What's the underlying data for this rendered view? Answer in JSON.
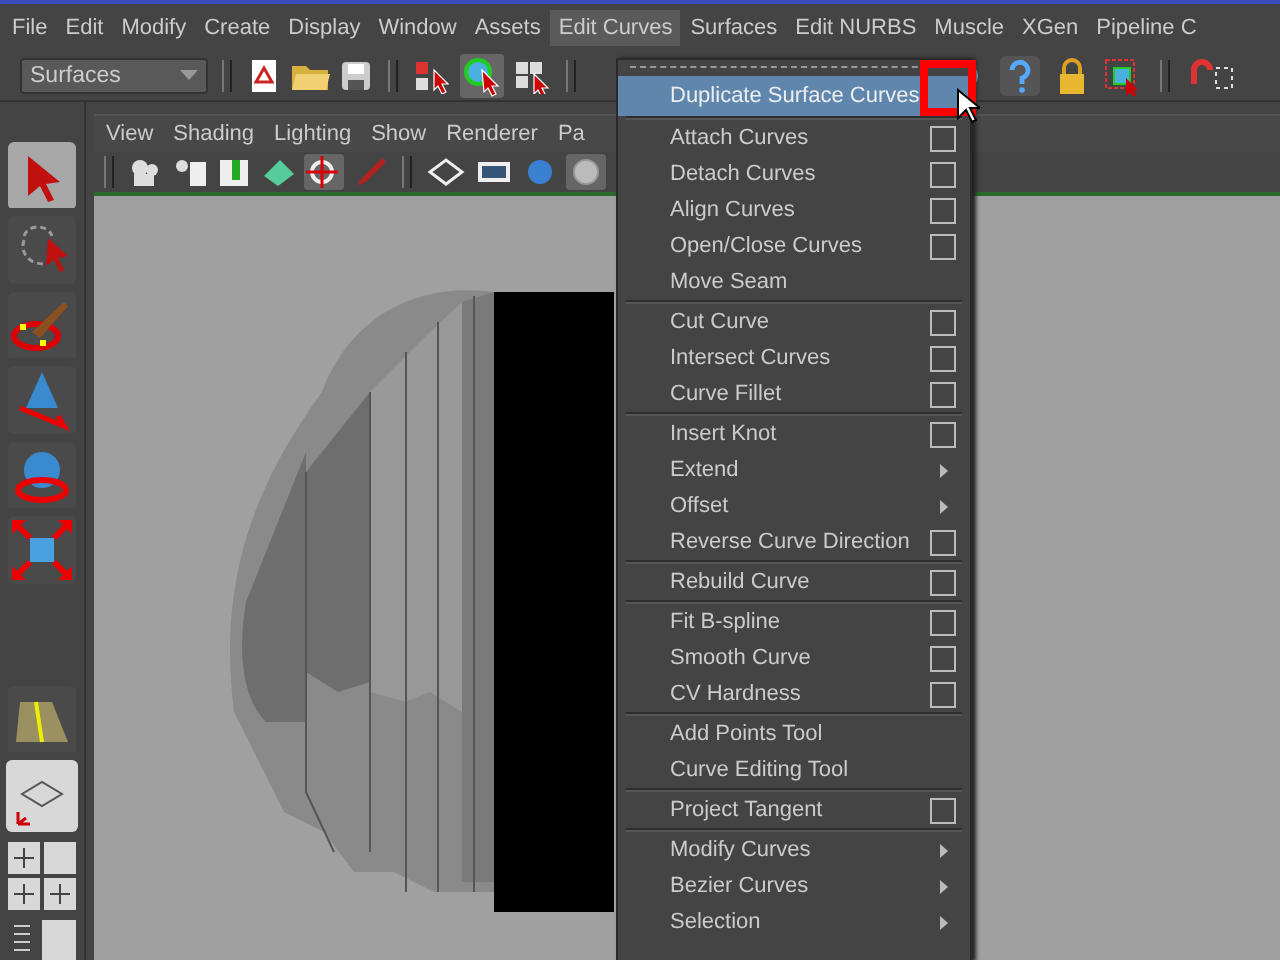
{
  "menubar": [
    {
      "label": "File",
      "selected": false
    },
    {
      "label": "Edit",
      "selected": false
    },
    {
      "label": "Modify",
      "selected": false
    },
    {
      "label": "Create",
      "selected": false
    },
    {
      "label": "Display",
      "selected": false
    },
    {
      "label": "Window",
      "selected": false
    },
    {
      "label": "Assets",
      "selected": false
    },
    {
      "label": "Edit Curves",
      "selected": true
    },
    {
      "label": "Surfaces",
      "selected": false
    },
    {
      "label": "Edit NURBS",
      "selected": false
    },
    {
      "label": "Muscle",
      "selected": false
    },
    {
      "label": "XGen",
      "selected": false
    },
    {
      "label": "Pipeline C",
      "selected": false
    }
  ],
  "toolbar": {
    "menu_set": "Surfaces"
  },
  "panel_menu": [
    "View",
    "Shading",
    "Lighting",
    "Show",
    "Renderer",
    "Pa"
  ],
  "menu": {
    "groups": [
      [
        {
          "label": "Duplicate Surface Curves",
          "kind": "option",
          "selected": true
        }
      ],
      [
        {
          "label": "Attach Curves",
          "kind": "option",
          "selected": false
        },
        {
          "label": "Detach Curves",
          "kind": "option",
          "selected": false
        },
        {
          "label": "Align Curves",
          "kind": "option",
          "selected": false
        },
        {
          "label": "Open/Close Curves",
          "kind": "option",
          "selected": false
        },
        {
          "label": "Move Seam",
          "kind": "plain",
          "selected": false
        }
      ],
      [
        {
          "label": "Cut Curve",
          "kind": "option",
          "selected": false
        },
        {
          "label": "Intersect Curves",
          "kind": "option",
          "selected": false
        },
        {
          "label": "Curve Fillet",
          "kind": "option",
          "selected": false
        }
      ],
      [
        {
          "label": "Insert Knot",
          "kind": "option",
          "selected": false
        },
        {
          "label": "Extend",
          "kind": "submenu",
          "selected": false
        },
        {
          "label": "Offset",
          "kind": "submenu",
          "selected": false
        },
        {
          "label": "Reverse Curve Direction",
          "kind": "option",
          "selected": false
        }
      ],
      [
        {
          "label": "Rebuild Curve",
          "kind": "option",
          "selected": false
        }
      ],
      [
        {
          "label": "Fit B-spline",
          "kind": "option",
          "selected": false
        },
        {
          "label": "Smooth Curve",
          "kind": "option",
          "selected": false
        },
        {
          "label": "CV Hardness",
          "kind": "option",
          "selected": false
        }
      ],
      [
        {
          "label": "Add Points Tool",
          "kind": "plain",
          "selected": false
        },
        {
          "label": "Curve Editing Tool",
          "kind": "plain",
          "selected": false
        }
      ],
      [
        {
          "label": "Project Tangent",
          "kind": "option",
          "selected": false
        }
      ],
      [
        {
          "label": "Modify Curves",
          "kind": "submenu",
          "selected": false
        },
        {
          "label": "Bezier Curves",
          "kind": "submenu",
          "selected": false
        },
        {
          "label": "Selection",
          "kind": "submenu",
          "selected": false
        }
      ]
    ]
  }
}
